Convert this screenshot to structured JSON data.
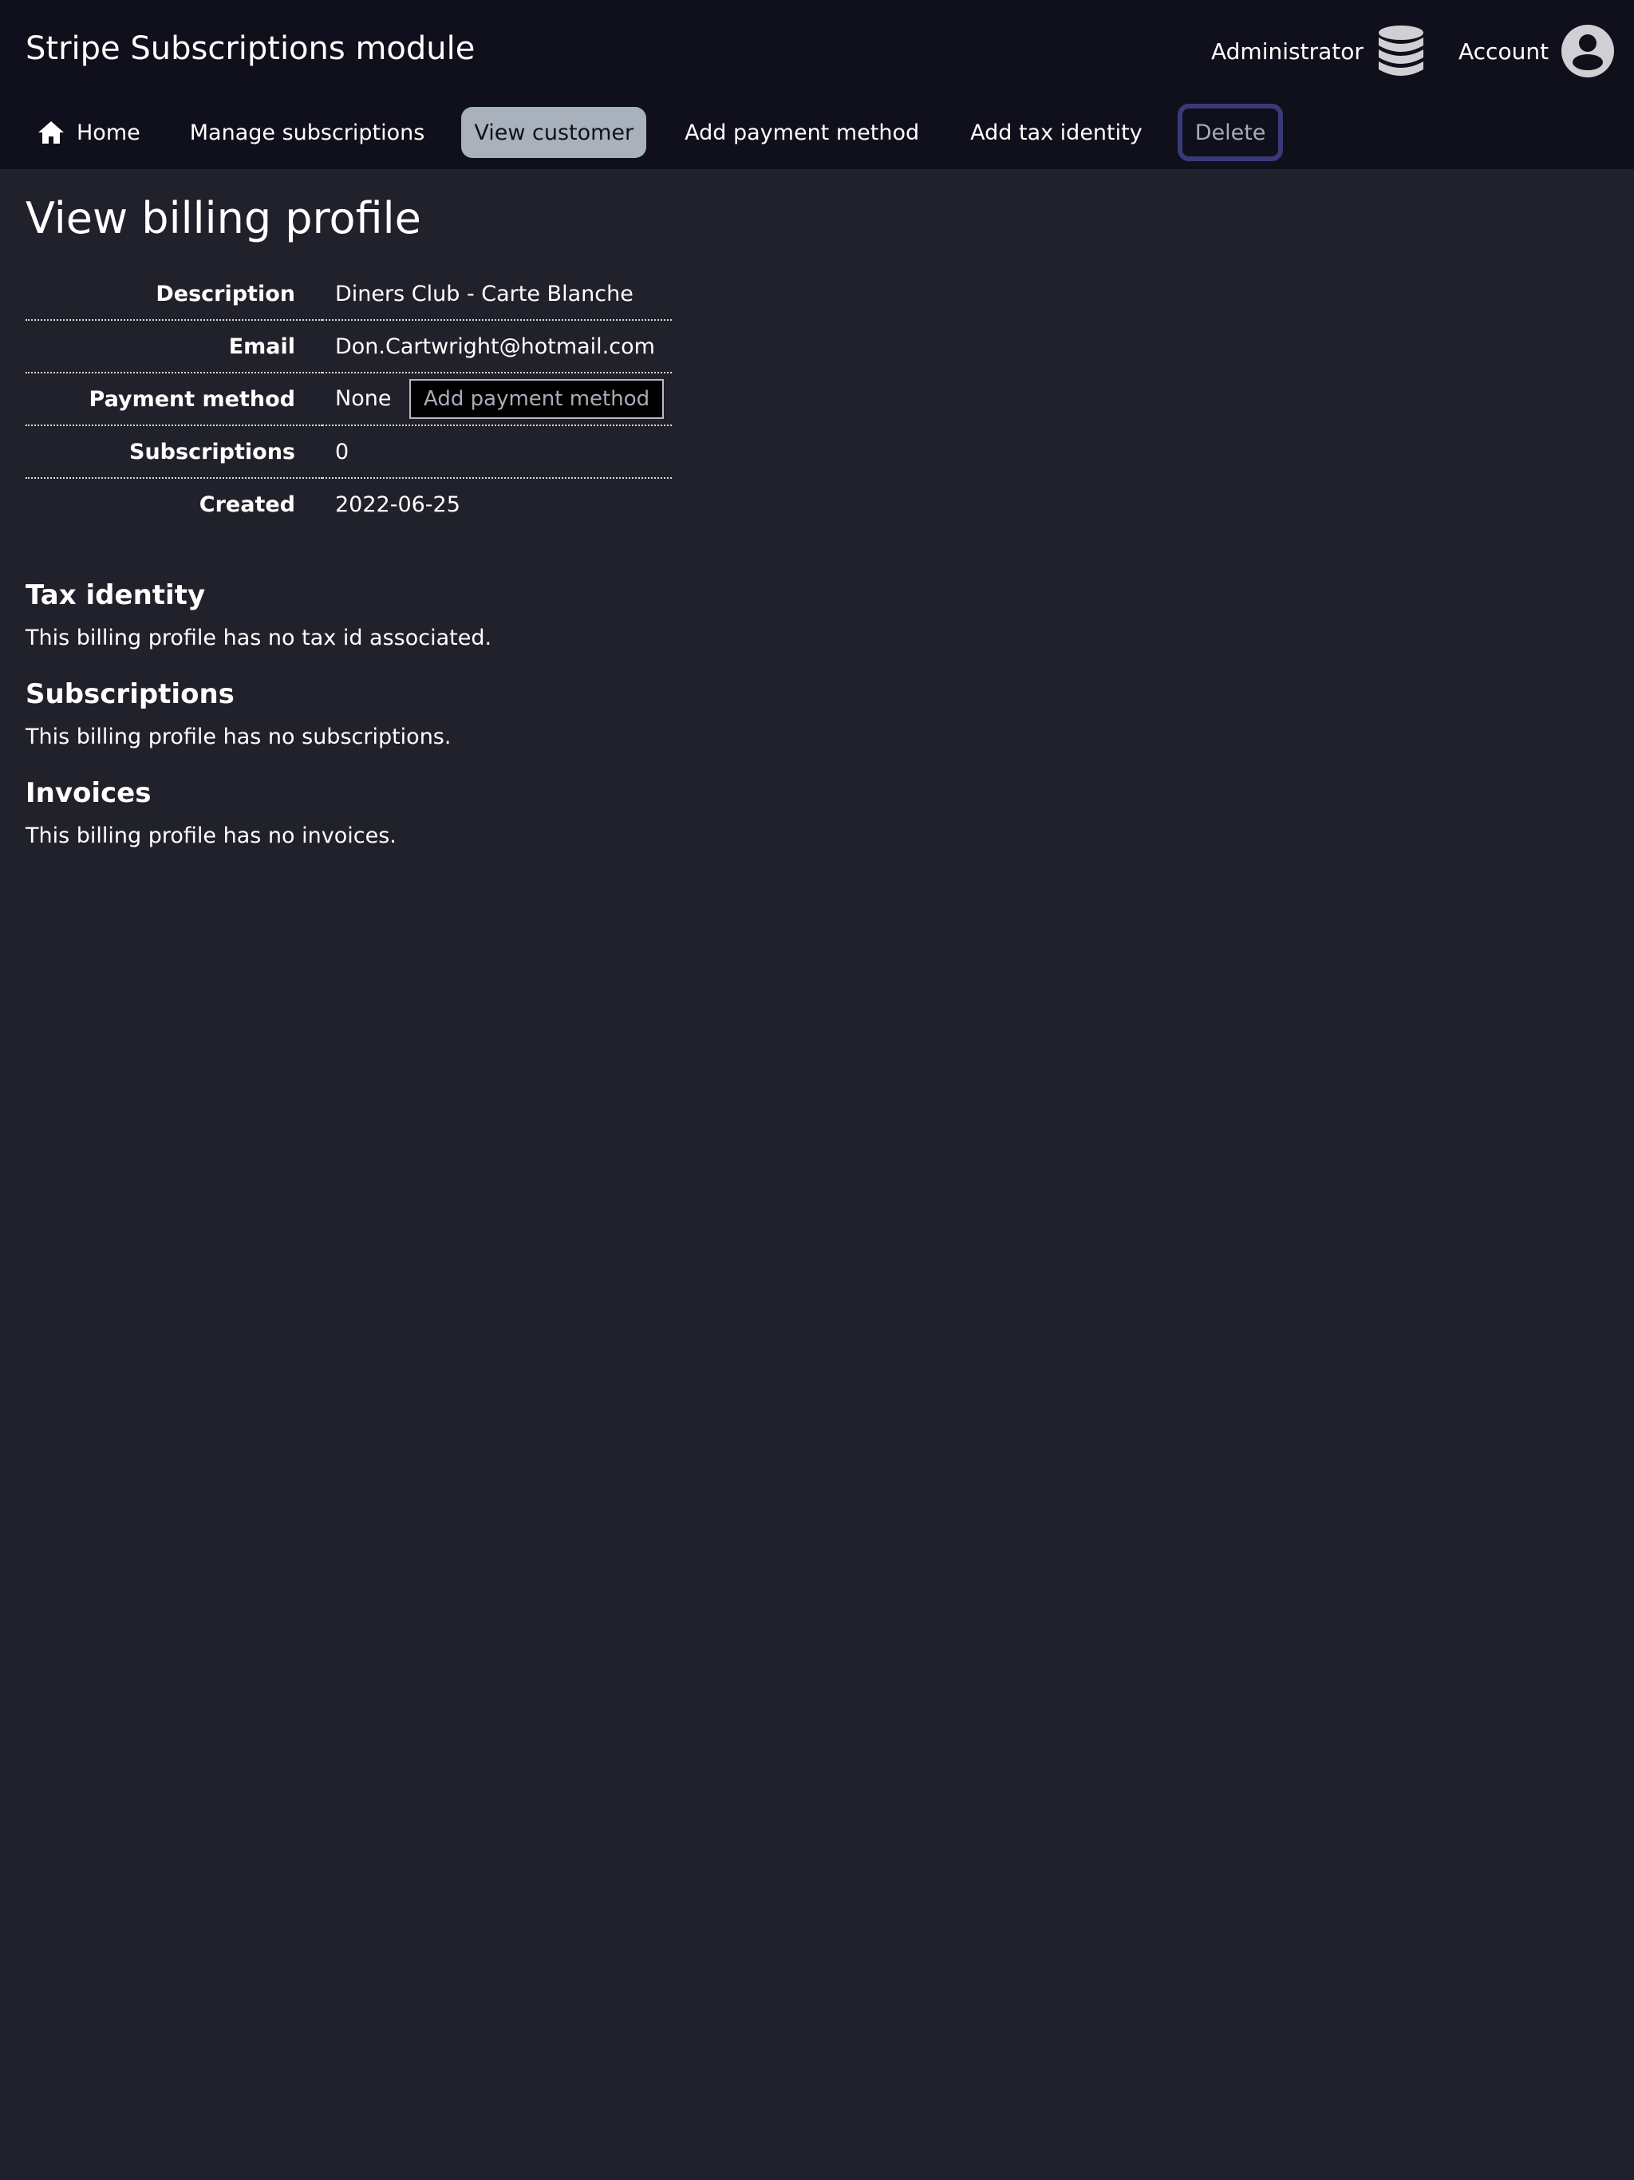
{
  "header": {
    "app_title": "Stripe Subscriptions module",
    "admin_label": "Administrator",
    "account_label": "Account"
  },
  "nav": {
    "home": "Home",
    "manage_subscriptions": "Manage subscriptions",
    "view_customer": "View customer",
    "add_payment_method": "Add payment method",
    "add_tax_identity": "Add tax identity",
    "delete": "Delete"
  },
  "page": {
    "title": "View billing profile"
  },
  "profile": {
    "rows": [
      {
        "label": "Description",
        "value": "Diners Club - Carte Blanche"
      },
      {
        "label": "Email",
        "value": "Don.Cartwright@hotmail.com"
      },
      {
        "label": "Payment method",
        "value": "None",
        "button": "Add payment method"
      },
      {
        "label": "Subscriptions",
        "value": "0"
      },
      {
        "label": "Created",
        "value": "2022-06-25"
      }
    ]
  },
  "sections": {
    "tax": {
      "heading": "Tax identity",
      "text": "This billing profile has no tax id associated."
    },
    "subscriptions": {
      "heading": "Subscriptions",
      "text": "This billing profile has no subscriptions."
    },
    "invoices": {
      "heading": "Invoices",
      "text": "This billing profile has no invoices."
    }
  },
  "icons": {
    "home": "home-icon",
    "admin": "database-icon",
    "account": "user-circle-icon"
  },
  "colors": {
    "background": "#21212b",
    "header_background": "#10101c",
    "active_tab": "#a9b2bc",
    "delete_border": "#3a3a78"
  }
}
